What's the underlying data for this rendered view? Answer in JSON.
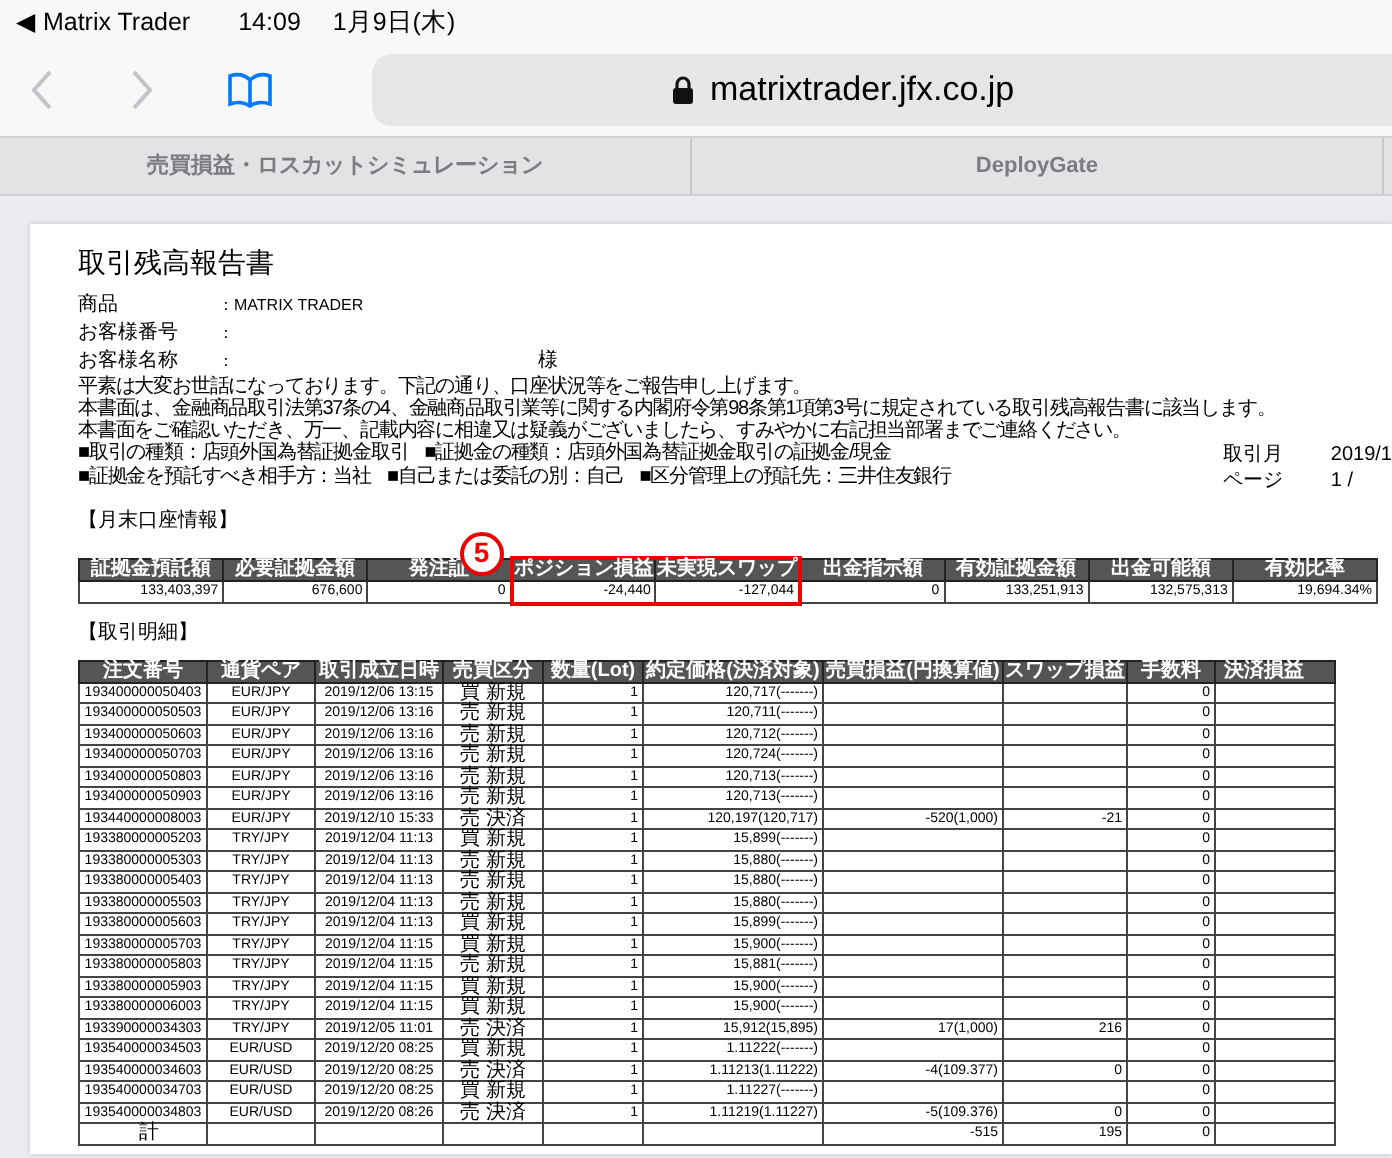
{
  "status_bar": {
    "back_app": "◀ Matrix Trader",
    "time": "14:09",
    "date": "1月9日(木)"
  },
  "browser": {
    "back_disabled": true,
    "forward_disabled": true,
    "url": "matrixtrader.jfx.co.jp",
    "secure": true
  },
  "tabs": [
    {
      "label": "売買損益・ロスカットシミュレーション",
      "selected": false
    },
    {
      "label": "DeployGate",
      "selected": false
    }
  ],
  "document": {
    "title": "取引残高報告書",
    "fields": [
      {
        "label": "商品",
        "value": "：MATRIX TRADER"
      },
      {
        "label": "お客様番号",
        "value": "："
      },
      {
        "label": "お客様名称",
        "value": "：",
        "suffix": "様"
      }
    ],
    "notice": [
      "平素は大変お世話になっております。下記の通り、口座状況等をご報告申し上げます。",
      "本書面は、金融商品取引法第37条の4、金融商品取引業等に関する内閣府令第98条第1項第3号に規定されている取引残高報告書に該当します。",
      "本書面をご確認いただき、万一、記載内容に相違又は疑義がございましたら、すみやかに右記担当部署までご連絡ください。"
    ],
    "info": [
      "■取引の種類：店頭外国為替証拠金取引",
      "■証拠金の種類：店頭外国為替証拠金取引の証拠金/現金",
      "■証拠金を預託すべき相手方：当社",
      "■自己または委託の別：自己",
      "■区分管理上の預託先：三井住友銀行"
    ],
    "meta": [
      {
        "label": "取引月",
        "value": "2019/1"
      },
      {
        "label": "ページ",
        "value": "1 /"
      }
    ],
    "summary": {
      "heading": "【月末口座情報】",
      "callout": "5",
      "columns": [
        {
          "header": "証拠金預託額",
          "value": "133,403,397",
          "highlighted": false
        },
        {
          "header": "必要証拠金額",
          "value": "676,600",
          "highlighted": false
        },
        {
          "header": "発注証",
          "value": "0",
          "highlighted": false
        },
        {
          "header": "ポジション損益",
          "value": "-24,440",
          "highlighted": true
        },
        {
          "header": "未実現スワップ",
          "value": "-127,044",
          "highlighted": true
        },
        {
          "header": "出金指示額",
          "value": "0",
          "highlighted": false
        },
        {
          "header": "有効証拠金額",
          "value": "133,251,913",
          "highlighted": false
        },
        {
          "header": "出金可能額",
          "value": "132,575,313",
          "highlighted": false
        },
        {
          "header": "有効比率",
          "value": "19,694.34%",
          "highlighted": false
        }
      ]
    },
    "trades": {
      "heading": "【取引明細】",
      "columns": [
        "注文番号",
        "通貨ペア",
        "取引成立日時",
        "売買区分",
        "数量(Lot)",
        "約定価格(決済対象)",
        "売買損益(円換算値)",
        "スワップ損益",
        "手数料",
        "決済損益"
      ],
      "rows": [
        {
          "order_no": "193400000050403",
          "pair": "EUR/JPY",
          "datetime": "2019/12/06 13:15",
          "side": "買 新規",
          "qty": "1",
          "price": "120,717(-------)",
          "fee": "0"
        },
        {
          "order_no": "193400000050503",
          "pair": "EUR/JPY",
          "datetime": "2019/12/06 13:16",
          "side": "売 新規",
          "qty": "1",
          "price": "120,711(-------)",
          "fee": "0"
        },
        {
          "order_no": "193400000050603",
          "pair": "EUR/JPY",
          "datetime": "2019/12/06 13:16",
          "side": "売 新規",
          "qty": "1",
          "price": "120,712(-------)",
          "fee": "0"
        },
        {
          "order_no": "193400000050703",
          "pair": "EUR/JPY",
          "datetime": "2019/12/06 13:16",
          "side": "売 新規",
          "qty": "1",
          "price": "120,724(-------)",
          "fee": "0"
        },
        {
          "order_no": "193400000050803",
          "pair": "EUR/JPY",
          "datetime": "2019/12/06 13:16",
          "side": "売 新規",
          "qty": "1",
          "price": "120,713(-------)",
          "fee": "0"
        },
        {
          "order_no": "193400000050903",
          "pair": "EUR/JPY",
          "datetime": "2019/12/06 13:16",
          "side": "売 新規",
          "qty": "1",
          "price": "120,713(-------)",
          "fee": "0"
        },
        {
          "order_no": "193440000008003",
          "pair": "EUR/JPY",
          "datetime": "2019/12/10 15:33",
          "side": "売 決済",
          "qty": "1",
          "price": "120,197(120,717)",
          "pl": "-520(1,000)",
          "swap": "-21",
          "fee": "0"
        },
        {
          "order_no": "193380000005203",
          "pair": "TRY/JPY",
          "datetime": "2019/12/04 11:13",
          "side": "買 新規",
          "qty": "1",
          "price": "15,899(-------)",
          "fee": "0"
        },
        {
          "order_no": "193380000005303",
          "pair": "TRY/JPY",
          "datetime": "2019/12/04 11:13",
          "side": "売 新規",
          "qty": "1",
          "price": "15,880(-------)",
          "fee": "0"
        },
        {
          "order_no": "193380000005403",
          "pair": "TRY/JPY",
          "datetime": "2019/12/04 11:13",
          "side": "売 新規",
          "qty": "1",
          "price": "15,880(-------)",
          "fee": "0"
        },
        {
          "order_no": "193380000005503",
          "pair": "TRY/JPY",
          "datetime": "2019/12/04 11:13",
          "side": "売 新規",
          "qty": "1",
          "price": "15,880(-------)",
          "fee": "0"
        },
        {
          "order_no": "193380000005603",
          "pair": "TRY/JPY",
          "datetime": "2019/12/04 11:13",
          "side": "買 新規",
          "qty": "1",
          "price": "15,899(-------)",
          "fee": "0"
        },
        {
          "order_no": "193380000005703",
          "pair": "TRY/JPY",
          "datetime": "2019/12/04 11:15",
          "side": "買 新規",
          "qty": "1",
          "price": "15,900(-------)",
          "fee": "0"
        },
        {
          "order_no": "193380000005803",
          "pair": "TRY/JPY",
          "datetime": "2019/12/04 11:15",
          "side": "売 新規",
          "qty": "1",
          "price": "15,881(-------)",
          "fee": "0"
        },
        {
          "order_no": "193380000005903",
          "pair": "TRY/JPY",
          "datetime": "2019/12/04 11:15",
          "side": "買 新規",
          "qty": "1",
          "price": "15,900(-------)",
          "fee": "0"
        },
        {
          "order_no": "193380000006003",
          "pair": "TRY/JPY",
          "datetime": "2019/12/04 11:15",
          "side": "買 新規",
          "qty": "1",
          "price": "15,900(-------)",
          "fee": "0"
        },
        {
          "order_no": "193390000034303",
          "pair": "TRY/JPY",
          "datetime": "2019/12/05 11:01",
          "side": "売 決済",
          "qty": "1",
          "price": "15,912(15,895)",
          "pl": "17(1,000)",
          "swap": "216",
          "fee": "0"
        },
        {
          "order_no": "193540000034503",
          "pair": "EUR/USD",
          "datetime": "2019/12/20 08:25",
          "side": "買 新規",
          "qty": "1",
          "price": "1.11222(-------)",
          "fee": "0"
        },
        {
          "order_no": "193540000034603",
          "pair": "EUR/USD",
          "datetime": "2019/12/20 08:25",
          "side": "売 決済",
          "qty": "1",
          "price": "1.11213(1.11222)",
          "pl": "-4(109.377)",
          "swap": "0",
          "fee": "0"
        },
        {
          "order_no": "193540000034703",
          "pair": "EUR/USD",
          "datetime": "2019/12/20 08:25",
          "side": "買 新規",
          "qty": "1",
          "price": "1.11227(-------)",
          "fee": "0"
        },
        {
          "order_no": "193540000034803",
          "pair": "EUR/USD",
          "datetime": "2019/12/20 08:26",
          "side": "売 決済",
          "qty": "1",
          "price": "1.11219(1.11227)",
          "pl": "-5(109.376)",
          "swap": "0",
          "fee": "0"
        }
      ],
      "total": {
        "label": "計",
        "pl": "-515",
        "swap": "195",
        "fee": "0"
      }
    }
  }
}
